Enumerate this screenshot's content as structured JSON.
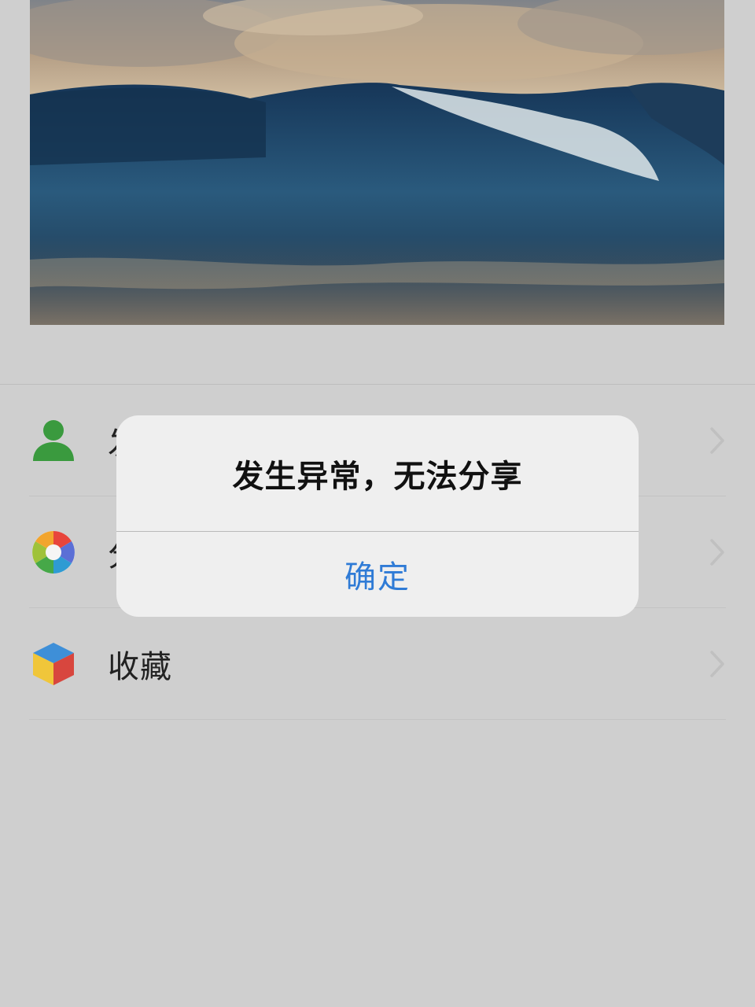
{
  "menu": {
    "items": [
      {
        "label": "发",
        "icon": "person-icon"
      },
      {
        "label": "分",
        "icon": "shutter-icon"
      },
      {
        "label": "收藏",
        "icon": "cube-icon"
      }
    ]
  },
  "dialog": {
    "message": "发生异常，无法分享",
    "confirm_label": "确定"
  },
  "colors": {
    "background": "#cfcfcf",
    "dialog_bg": "#efefef",
    "confirm_text": "#2f7bd6",
    "person_icon": "#3a9a3e"
  }
}
